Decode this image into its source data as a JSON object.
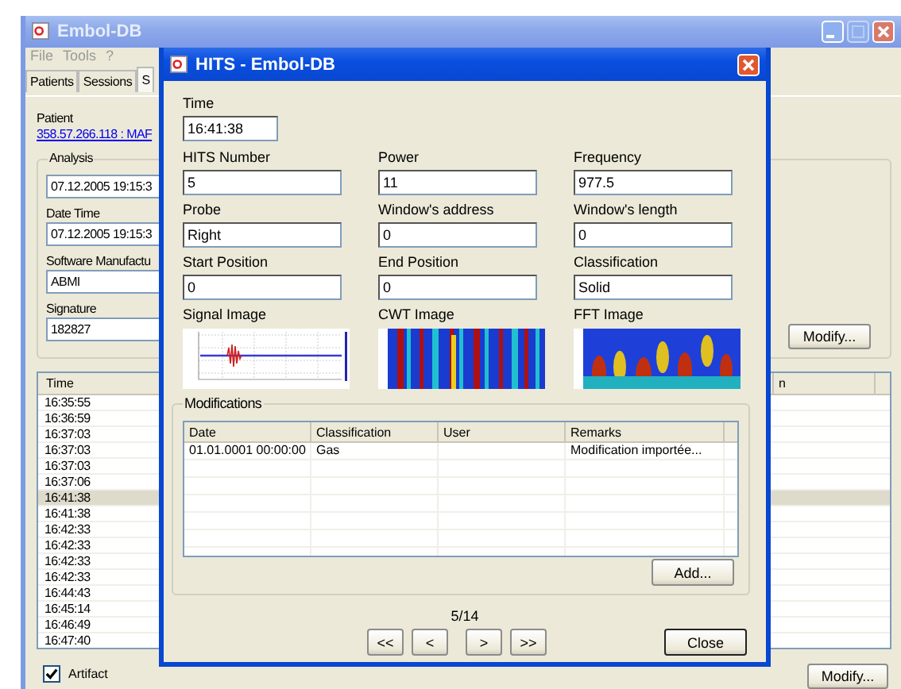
{
  "main_window": {
    "title": "Embol-DB",
    "menu": [
      "File",
      "Tools",
      "?"
    ],
    "tabs": [
      {
        "label": "Patients",
        "selected": false
      },
      {
        "label": "Sessions",
        "selected": false
      },
      {
        "label": "S",
        "selected": true
      }
    ],
    "patient": {
      "label": "Patient",
      "link": "358.57.266.118 : MAF"
    },
    "analysis": {
      "title": "Analysis",
      "fields": [
        {
          "value": "07.12.2005 19:15:3"
        },
        {
          "label": "Date Time",
          "value": "07.12.2005 19:15:3"
        },
        {
          "label": "Software Manufactu",
          "value": "ABMI"
        },
        {
          "label": "Signature",
          "value": "182827"
        }
      ],
      "button": "Modify..."
    },
    "list": {
      "columns": [
        "Time",
        "n"
      ],
      "rows": [
        {
          "time": "16:35:55",
          "selected": false
        },
        {
          "time": "16:36:59",
          "selected": false
        },
        {
          "time": "16:37:03",
          "selected": false
        },
        {
          "time": "16:37:03",
          "selected": false
        },
        {
          "time": "16:37:03",
          "selected": false
        },
        {
          "time": "16:37:06",
          "selected": false
        },
        {
          "time": "16:41:38",
          "selected": true
        },
        {
          "time": "16:41:38",
          "selected": false
        },
        {
          "time": "16:42:33",
          "selected": false
        },
        {
          "time": "16:42:33",
          "selected": false
        },
        {
          "time": "16:42:33",
          "selected": false
        },
        {
          "time": "16:42:33",
          "selected": false
        },
        {
          "time": "16:44:43",
          "selected": false
        },
        {
          "time": "16:45:14",
          "selected": false
        },
        {
          "time": "16:46:49",
          "selected": false
        },
        {
          "time": "16:47:40",
          "selected": false
        }
      ]
    },
    "artifact": {
      "label": "Artifact",
      "checked": true
    },
    "button": "Modify..."
  },
  "dialog": {
    "title": "HITS - Embol-DB",
    "time": {
      "label": "Time",
      "value": "16:41:38"
    },
    "fields": [
      {
        "label": "HITS Number",
        "value": "5"
      },
      {
        "label": "Power",
        "value": "11"
      },
      {
        "label": "Frequency",
        "value": "977.5"
      },
      {
        "label": "Probe",
        "value": "Right"
      },
      {
        "label": "Window's address",
        "value": "0"
      },
      {
        "label": "Window's length",
        "value": "0"
      },
      {
        "label": "Start Position",
        "value": "0"
      },
      {
        "label": "End Position",
        "value": "0"
      },
      {
        "label": "Classification",
        "value": "Solid"
      }
    ],
    "images": [
      {
        "label": "Signal Image",
        "kind": "signal"
      },
      {
        "label": "CWT Image",
        "kind": "cwt"
      },
      {
        "label": "FFT Image",
        "kind": "fft"
      }
    ],
    "modifications": {
      "title": "Modifications",
      "columns": [
        "Date",
        "Classification",
        "User",
        "Remarks"
      ],
      "rows": [
        {
          "date": "01.01.0001 00:00:00",
          "classification": "Gas",
          "remarks": "Modification importée..."
        }
      ],
      "button": "Add..."
    },
    "position": "5/14",
    "nav": [
      "<<",
      "<",
      ">",
      ">>"
    ],
    "close_button": "Close"
  }
}
